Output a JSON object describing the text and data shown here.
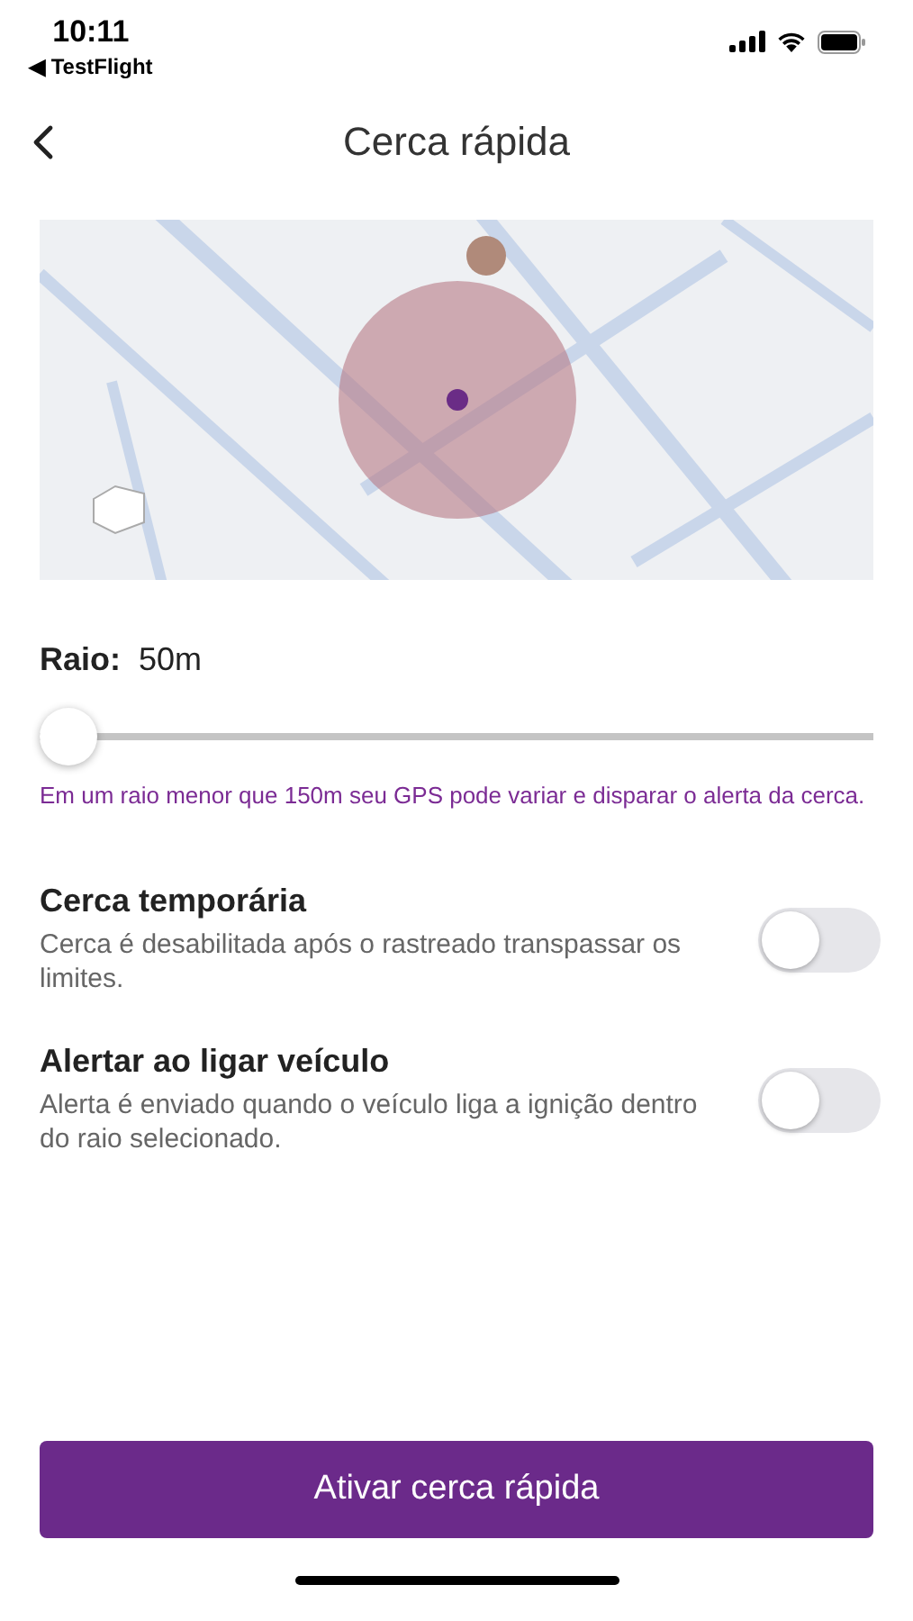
{
  "status_bar": {
    "time": "10:11",
    "back_app": "◀ TestFlight"
  },
  "header": {
    "title": "Cerca rápida"
  },
  "radius": {
    "label": "Raio:",
    "value": "50m",
    "level": 0.0,
    "hint": "Em um raio menor que 150m seu GPS pode variar e disparar o alerta da cerca."
  },
  "options": [
    {
      "title": "Cerca temporária",
      "description": "Cerca é desabilitada após o rastreado transpassar os limites.",
      "on": false
    },
    {
      "title": "Alertar ao ligar veículo",
      "description": "Alerta é enviado quando o veículo liga a ignição dentro do raio selecionado.",
      "on": false
    }
  ],
  "primary_button": "Ativar cerca rápida"
}
